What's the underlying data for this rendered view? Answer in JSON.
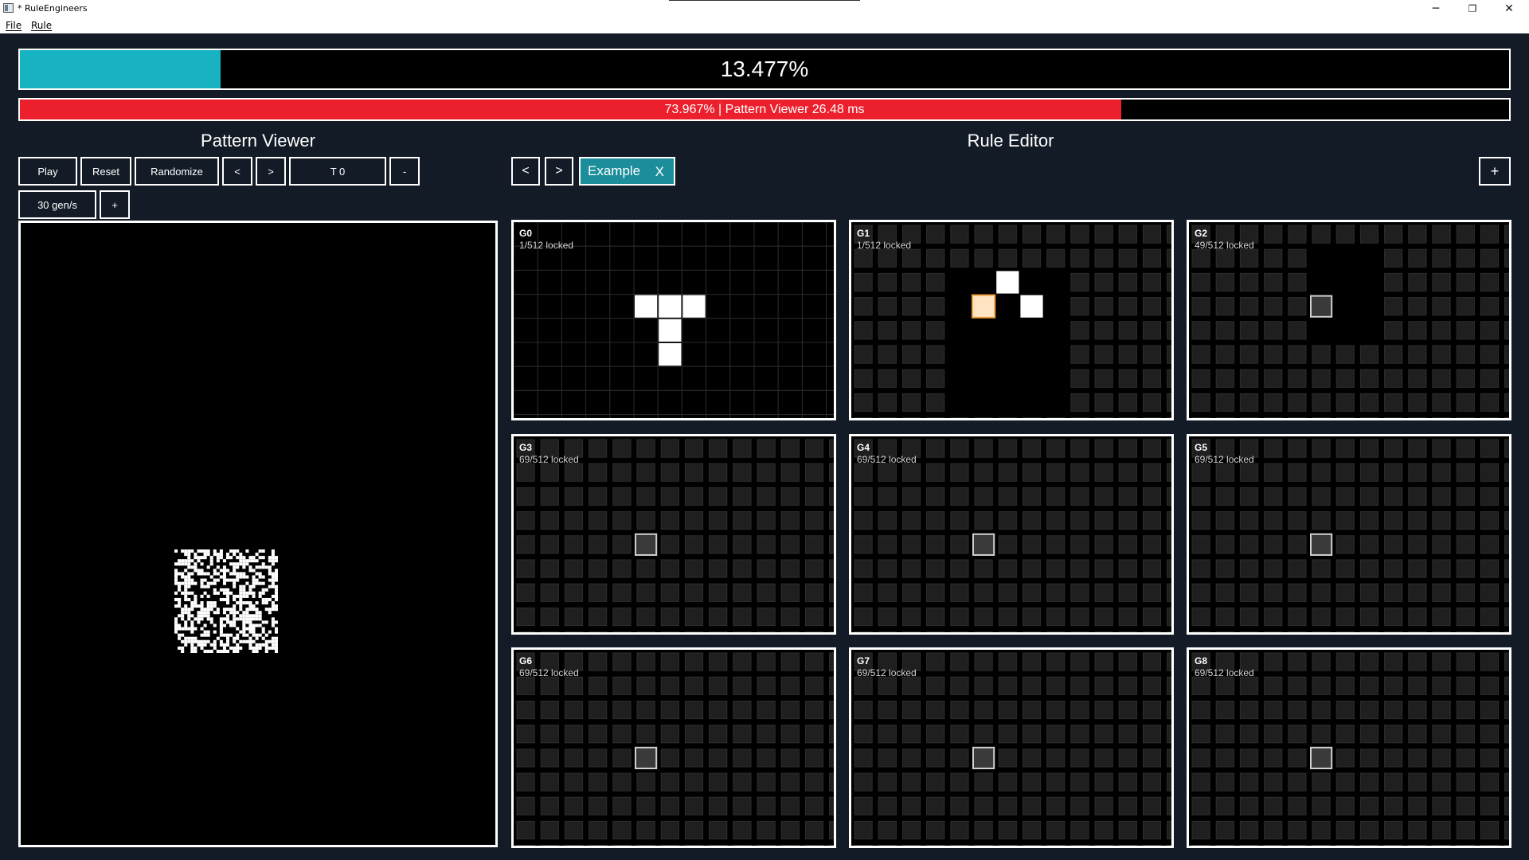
{
  "window": {
    "title": "* RuleEngineers",
    "minimize_glyph": "─",
    "restore_glyph": "❐",
    "close_glyph": "✕"
  },
  "menu": {
    "items": [
      {
        "label": "File"
      },
      {
        "label": "Rule"
      }
    ]
  },
  "progress_main": {
    "label": "13.477%",
    "fraction": 0.13477,
    "fill_color": "#17b3c2"
  },
  "progress_perf": {
    "label": "73.967% | Pattern Viewer 26.48 ms",
    "fraction": 0.73967,
    "fill_color": "#ec1f2c"
  },
  "pattern_viewer": {
    "title": "Pattern Viewer",
    "buttons": {
      "play": "Play",
      "reset": "Reset",
      "randomize": "Randomize",
      "prev": "<",
      "next": ">",
      "time": "T 0",
      "minus": "-",
      "speed": "30 gen/s",
      "plus": "+"
    }
  },
  "rule_editor": {
    "title": "Rule Editor",
    "prev": "<",
    "next": ">",
    "tab_label": "Example",
    "tab_close": "X",
    "add": "+",
    "generations": [
      {
        "name": "G0",
        "locked": "1/512 locked"
      },
      {
        "name": "G1",
        "locked": "1/512 locked"
      },
      {
        "name": "G2",
        "locked": "49/512 locked"
      },
      {
        "name": "G3",
        "locked": "69/512 locked"
      },
      {
        "name": "G4",
        "locked": "69/512 locked"
      },
      {
        "name": "G5",
        "locked": "69/512 locked"
      },
      {
        "name": "G6",
        "locked": "69/512 locked"
      },
      {
        "name": "G7",
        "locked": "69/512 locked"
      },
      {
        "name": "G8",
        "locked": "69/512 locked"
      }
    ]
  },
  "colors": {
    "background": "#131b27",
    "accent": "#17b3c2",
    "tab": "#1c8e9b",
    "perf": "#ec1f2c",
    "highlight_cell": "#ffe4c4",
    "highlight_border": "#f0a040"
  }
}
